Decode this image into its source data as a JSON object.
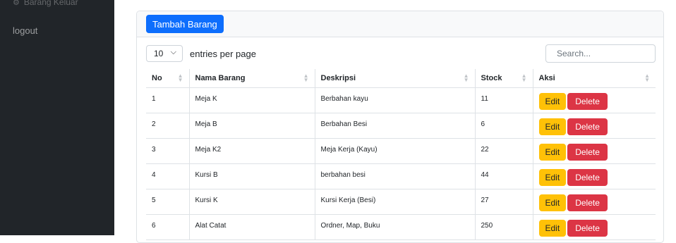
{
  "sidebar": {
    "cut_item_label": "Barang Keluar",
    "cut_item_icon": "gear-icon",
    "logout_label": "logout"
  },
  "card": {
    "add_button_label": "Tambah Barang"
  },
  "datatable": {
    "per_page_value": "10",
    "entries_label": "entries per page",
    "search_placeholder": "Search...",
    "columns": [
      "No",
      "Nama Barang",
      "Deskripsi",
      "Stock",
      "Aksi"
    ],
    "rows": [
      {
        "no": "1",
        "nama": "Meja K",
        "deskripsi": "Berbahan kayu",
        "stock": "11"
      },
      {
        "no": "2",
        "nama": "Meja B",
        "deskripsi": "Berbahan Besi",
        "stock": "6"
      },
      {
        "no": "3",
        "nama": "Meja K2",
        "deskripsi": "Meja Kerja (Kayu)",
        "stock": "22"
      },
      {
        "no": "4",
        "nama": "Kursi B",
        "deskripsi": "berbahan besi",
        "stock": "44"
      },
      {
        "no": "5",
        "nama": "Kursi K",
        "deskripsi": "Kursi Kerja (Besi)",
        "stock": "27"
      },
      {
        "no": "6",
        "nama": "Alat Catat",
        "deskripsi": "Ordner, Map, Buku",
        "stock": "250"
      }
    ],
    "edit_label": "Edit",
    "delete_label": "Delete"
  },
  "colors": {
    "sidebar_bg": "#212529",
    "primary": "#0d6efd",
    "warning": "#ffc107",
    "danger": "#dc3545"
  }
}
